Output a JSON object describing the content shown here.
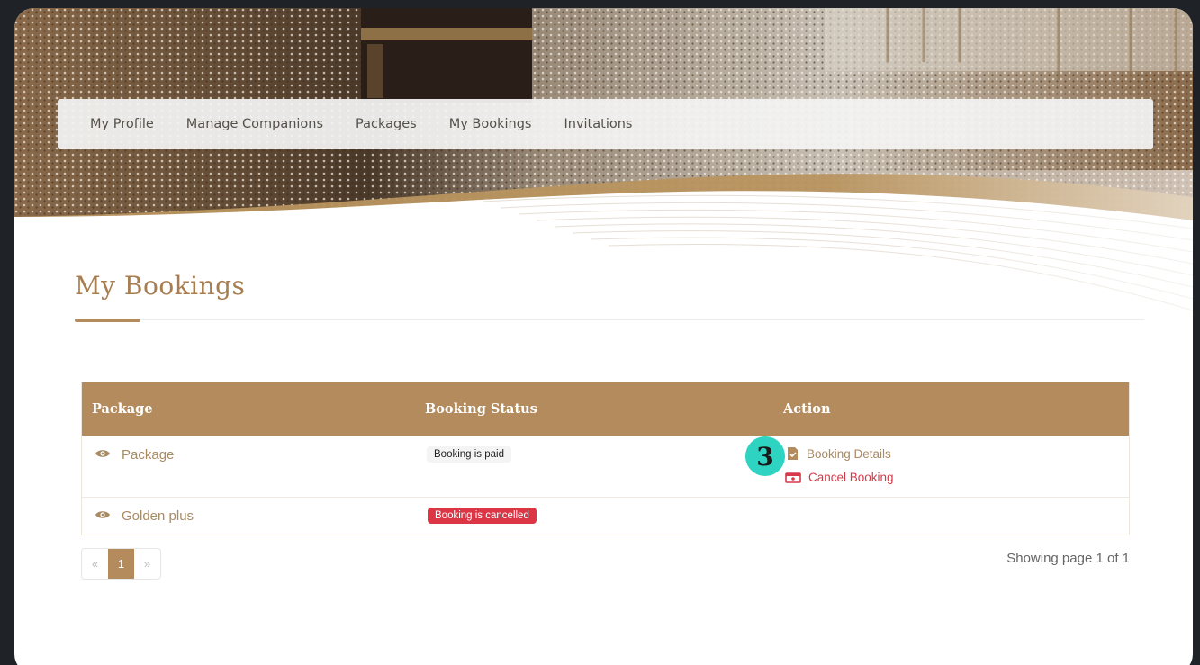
{
  "nav": {
    "items": [
      "My Profile",
      "Manage Companions",
      "Packages",
      "My Bookings",
      "Invitations"
    ]
  },
  "page": {
    "title": "My Bookings"
  },
  "table": {
    "headers": [
      "Package",
      "Booking Status",
      "Action"
    ],
    "rows": [
      {
        "package": "Package",
        "status": "Booking is paid",
        "actions": {
          "details": "Booking Details",
          "cancel": "Cancel Booking"
        }
      },
      {
        "package": "Golden plus",
        "status": "Booking is cancelled"
      }
    ]
  },
  "marker": {
    "label": "3"
  },
  "pagination": {
    "prev": "«",
    "current": "1",
    "next": "»",
    "info": "Showing page 1 of 1"
  },
  "icons": {
    "view": "eye-icon",
    "details": "document-check-icon",
    "cancel": "cancel-ticket-icon"
  },
  "colors": {
    "accent": "#b38b5d",
    "danger": "#dc3545",
    "marker": "#2ed3c2"
  }
}
